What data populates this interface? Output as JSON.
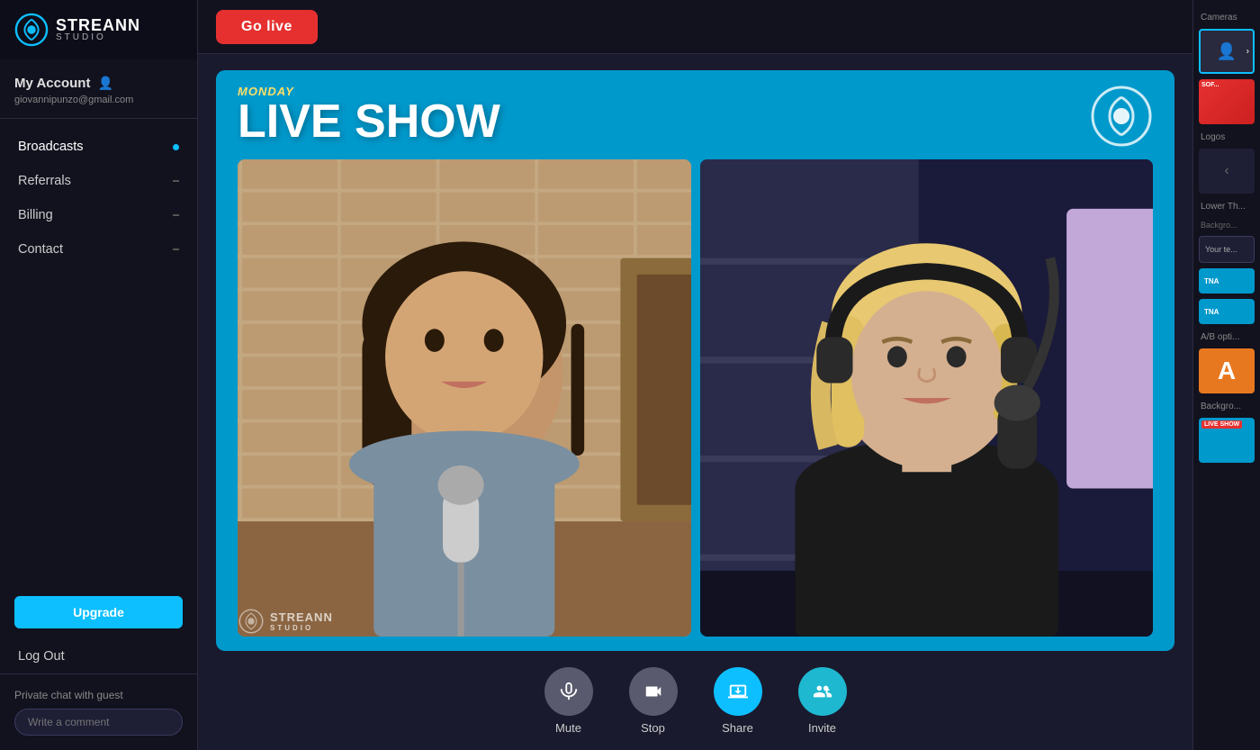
{
  "app": {
    "name": "STREANN",
    "subtitle": "STUDIO"
  },
  "sidebar": {
    "account_label": "My Account",
    "account_email": "giovannipunzo@gmail.com",
    "nav_items": [
      {
        "label": "Broadcasts",
        "active": true,
        "indicator": "dot"
      },
      {
        "label": "Referrals",
        "active": false,
        "indicator": "dash"
      },
      {
        "label": "Billing",
        "active": false,
        "indicator": "dash"
      },
      {
        "label": "Contact",
        "active": false,
        "indicator": "dash"
      }
    ],
    "upgrade_label": "Upgrade",
    "logout_label": "Log Out",
    "private_chat_label": "Private chat with guest",
    "comment_placeholder": "Write a comment"
  },
  "topbar": {
    "go_live_label": "Go live"
  },
  "stage": {
    "day_label": "MONDAY",
    "title_label": "LIVE SHOW"
  },
  "controls": [
    {
      "id": "mute",
      "label": "Mute",
      "icon": "🎤",
      "style": "gray"
    },
    {
      "id": "stop",
      "label": "Stop",
      "icon": "📷",
      "style": "gray"
    },
    {
      "id": "share",
      "label": "Share",
      "icon": "🖥",
      "style": "blue"
    },
    {
      "id": "invite",
      "label": "Invite",
      "icon": "👥",
      "style": "teal"
    }
  ],
  "right_panel": {
    "cameras_label": "Cameras",
    "logos_label": "Logos",
    "lower_third_label": "Lower Th...",
    "background_label": "Backgro...",
    "ab_option_label": "A/B opti...",
    "ab_letter": "A",
    "background2_label": "Backgro...",
    "lower_text_placeholder": "Your te...",
    "live_badge": "LIVE SHOW",
    "live_label": "TNA",
    "live_label2": "TNA"
  },
  "colors": {
    "accent_blue": "#0dbfff",
    "stage_bg": "#0099cc",
    "go_live_red": "#e63030",
    "upgrade_blue": "#0dbfff",
    "ab_orange": "#e87820",
    "sidebar_bg": "#12121f",
    "main_bg": "#1a1a2e"
  }
}
